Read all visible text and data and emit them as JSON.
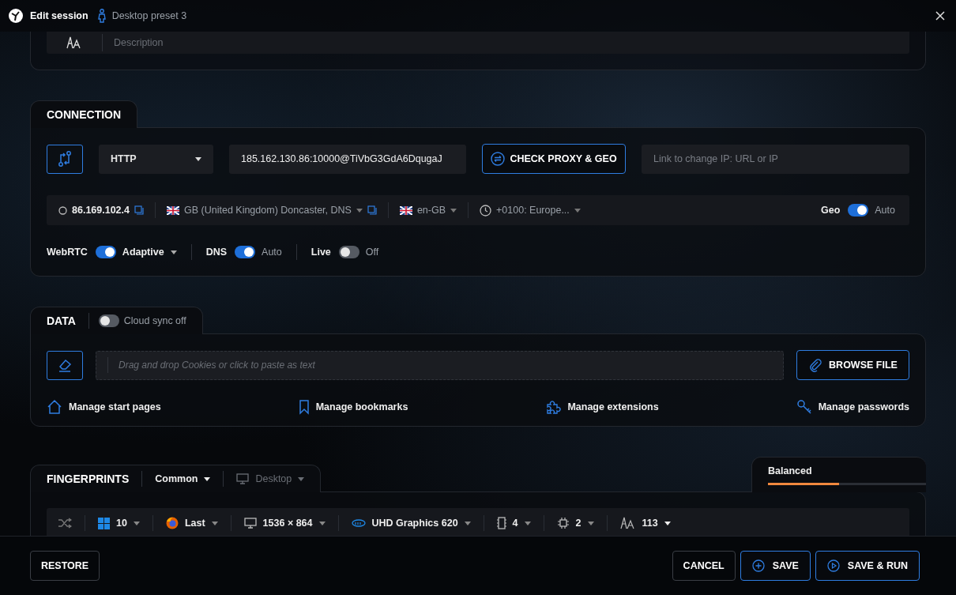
{
  "window": {
    "title": "Edit session",
    "preset": "Desktop preset 3"
  },
  "description": {
    "placeholder": "Description"
  },
  "connection": {
    "title": "CONNECTION",
    "proxy_type": "HTTP",
    "proxy_value": "185.162.130.86:10000@TiVbG3GdA6DqugaJ",
    "check_button": "CHECK PROXY & GEO",
    "change_ip_placeholder": "Link to change IP: URL or IP",
    "ip": "86.169.102.4",
    "location": "GB (United Kingdom) Doncaster, DNS",
    "language": "en-GB",
    "timezone": "+0100: Europe...",
    "geo": {
      "label": "Geo",
      "on": true,
      "value": "Auto"
    },
    "toggles": [
      {
        "label": "WebRTC",
        "on": true,
        "value": "Adaptive",
        "kind": "dropdown"
      },
      {
        "label": "DNS",
        "on": true,
        "value": "Auto",
        "kind": "plain"
      },
      {
        "label": "Live",
        "on": false,
        "value": "Off",
        "kind": "plain"
      }
    ]
  },
  "data": {
    "title": "DATA",
    "cloud_sync": {
      "on": false,
      "label": "Cloud sync off"
    },
    "drop_placeholder": "Drag and drop Cookies or click to paste as text",
    "browse_button": "BROWSE FILE",
    "links": [
      {
        "label": "Manage start pages",
        "kind": "home"
      },
      {
        "label": "Manage bookmarks",
        "kind": "bookmark"
      },
      {
        "label": "Manage extensions",
        "kind": "puzzle"
      },
      {
        "label": "Manage passwords",
        "kind": "key"
      }
    ]
  },
  "fingerprints": {
    "title": "FINGERPRINTS",
    "dropdowns": [
      {
        "label": "Common",
        "kind": "profile",
        "disabled": false
      },
      {
        "label": "Desktop",
        "kind": "monitor",
        "disabled": true
      }
    ],
    "mode": {
      "label": "Balanced",
      "level": 0.45
    },
    "items": [
      {
        "kind": "shuffle"
      },
      {
        "kind": "windows",
        "value": "10"
      },
      {
        "kind": "browser",
        "value": "Last"
      },
      {
        "kind": "monitor",
        "value": "1536 × 864"
      },
      {
        "kind": "gpu",
        "value": "UHD Graphics 620"
      },
      {
        "kind": "cpu",
        "value": "4"
      },
      {
        "kind": "chip",
        "value": "2"
      },
      {
        "kind": "font",
        "value": "113"
      }
    ]
  },
  "footer": {
    "restore": "RESTORE",
    "cancel": "CANCEL",
    "save": "SAVE",
    "save_run": "SAVE & RUN"
  }
}
